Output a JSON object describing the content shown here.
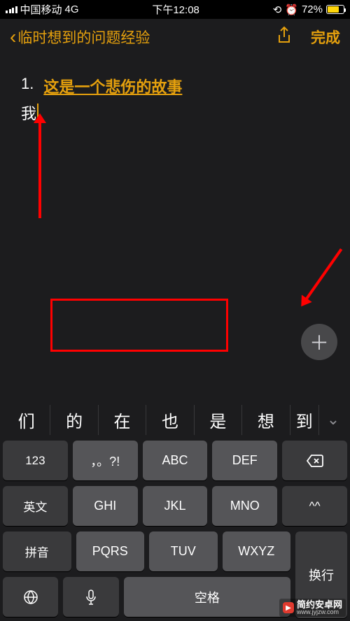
{
  "status": {
    "carrier": "中国移动",
    "network": "4G",
    "time": "下午12:08",
    "battery_pct": "72%"
  },
  "nav": {
    "back_label": "临时想到的问题经验",
    "done_label": "完成"
  },
  "note": {
    "list_number": "1.",
    "list_text": "这是一个悲伤的故事",
    "typed": "我"
  },
  "keyboard": {
    "suggestions": [
      "们",
      "的",
      "在",
      "也",
      "是",
      "想",
      "到"
    ],
    "row1": {
      "func": "123",
      "keys": [
        "，。?!",
        "ABC",
        "DEF"
      ],
      "del": "⌫"
    },
    "row2": {
      "func": "英文",
      "keys": [
        "GHI",
        "JKL",
        "MNO"
      ],
      "right": "^^"
    },
    "row3": {
      "func": "拼音",
      "keys": [
        "PQRS",
        "TUV",
        "WXYZ"
      ]
    },
    "row4": {
      "space": "空格"
    },
    "enter": "换行"
  },
  "watermark": {
    "title": "简约安卓网",
    "url": "www.jyjzw.com"
  }
}
